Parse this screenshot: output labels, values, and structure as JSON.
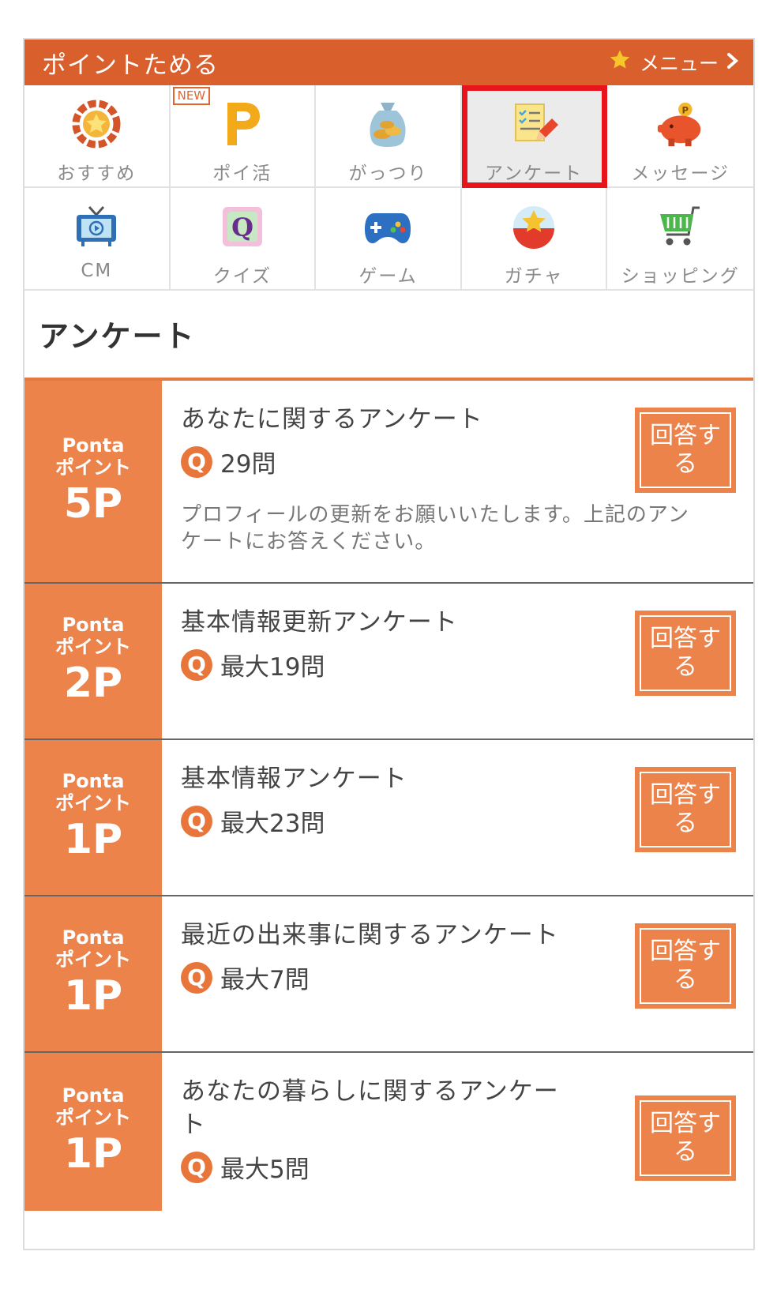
{
  "header": {
    "title": "ポイントためる",
    "menu_label": "メニュー"
  },
  "categories": [
    {
      "label": "おすすめ",
      "icon": "laurel-star-icon"
    },
    {
      "label": "ポイ活",
      "icon": "p-letter-icon",
      "badge": "NEW"
    },
    {
      "label": "がっつり",
      "icon": "money-bag-icon"
    },
    {
      "label": "アンケート",
      "icon": "notepad-pencil-icon",
      "selected": true
    },
    {
      "label": "メッセージ",
      "icon": "piggy-bank-icon"
    },
    {
      "label": "CM",
      "icon": "tv-icon"
    },
    {
      "label": "クイズ",
      "icon": "quiz-q-icon"
    },
    {
      "label": "ゲーム",
      "icon": "gamepad-icon"
    },
    {
      "label": "ガチャ",
      "icon": "gacha-capsule-icon"
    },
    {
      "label": "ショッピング",
      "icon": "shopping-cart-icon"
    }
  ],
  "section_title": "アンケート",
  "surveys": [
    {
      "ponta": "Ponta",
      "point_label": "ポイント",
      "points": "5P",
      "title": "あなたに関するアンケート",
      "questions": "29問",
      "description": "プロフィールの更新をお願いいたします。上記のアンケートにお答えください。",
      "answer_label": "回答する"
    },
    {
      "ponta": "Ponta",
      "point_label": "ポイント",
      "points": "2P",
      "title": "基本情報更新アンケート",
      "questions": "最大19問",
      "answer_label": "回答する"
    },
    {
      "ponta": "Ponta",
      "point_label": "ポイント",
      "points": "1P",
      "title": "基本情報アンケート",
      "questions": "最大23問",
      "answer_label": "回答する"
    },
    {
      "ponta": "Ponta",
      "point_label": "ポイント",
      "points": "1P",
      "title": "最近の出来事に関するアンケート",
      "questions": "最大7問",
      "answer_label": "回答する"
    },
    {
      "ponta": "Ponta",
      "point_label": "ポイント",
      "points": "1P",
      "title": "あなたの暮らしに関するアンケート",
      "questions": "最大5問",
      "answer_label": "回答する"
    }
  ],
  "q_icon_letter": "Q",
  "colors": {
    "header": "#d9602c",
    "accent": "#ec834b",
    "selected_border": "#e8141b"
  }
}
